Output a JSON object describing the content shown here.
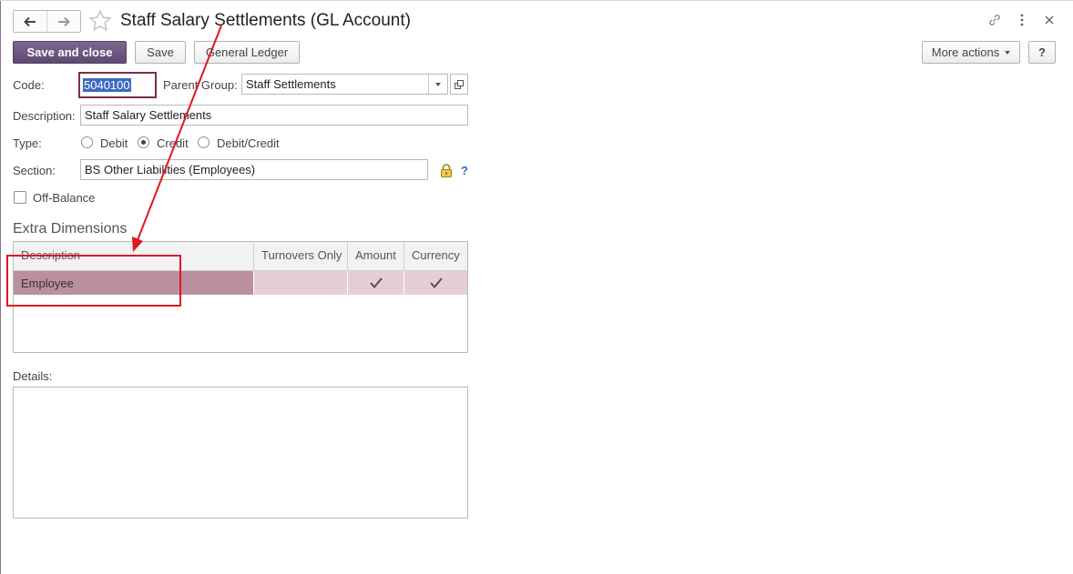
{
  "window": {
    "title": "Staff Salary Settlements (GL Account)",
    "back_icon": "arrow-left-icon",
    "forward_icon": "arrow-right-icon",
    "favorite_icon": "star-icon",
    "link_icon": "link-icon",
    "menu_icon": "more-vertical-icon",
    "close_icon": "close-icon"
  },
  "toolbar": {
    "save_and_close": "Save and close",
    "save": "Save",
    "general_ledger": "General Ledger",
    "more_actions": "More actions",
    "help": "?"
  },
  "form": {
    "code_label": "Code:",
    "code_value": "5040100",
    "parent_group_label": "Parent Group:",
    "parent_group_value": "Staff Settlements",
    "description_label": "Description:",
    "description_value": "Staff Salary Settlements",
    "type_label": "Type:",
    "type_options": [
      {
        "label": "Debit",
        "selected": false
      },
      {
        "label": "Credit",
        "selected": true
      },
      {
        "label": "Debit/Credit",
        "selected": false
      }
    ],
    "section_label": "Section:",
    "section_value": "BS Other Liabilities (Employees)",
    "section_help": "?",
    "off_balance_label": "Off-Balance",
    "off_balance_checked": false
  },
  "extra_dimensions": {
    "title": "Extra Dimensions",
    "columns": [
      "Description",
      "Turnovers Only",
      "Amount",
      "Currency"
    ],
    "rows": [
      {
        "description": "Employee",
        "turnovers_only": false,
        "amount": true,
        "currency": true
      }
    ]
  },
  "details": {
    "label": "Details:",
    "value": ""
  },
  "colors": {
    "primary_button": "#6a547e",
    "selected_row": "#bc8f9e",
    "selected_row_light": "#e5cfd7",
    "annotation": "#e0171d",
    "code_border": "#7a2e4a"
  }
}
